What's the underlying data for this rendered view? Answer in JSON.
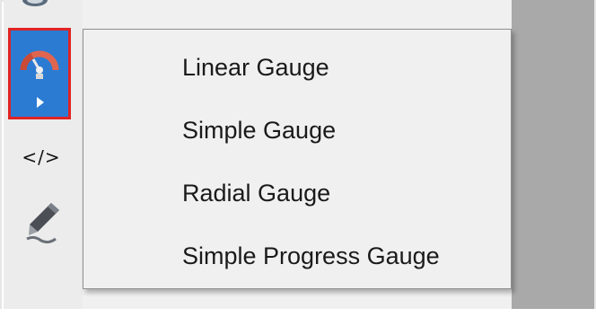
{
  "toolbar": {
    "icons": [
      "partial-icon",
      "gauge-icon",
      "code-icon",
      "pen-icon"
    ],
    "code_label": "</>"
  },
  "menu": {
    "items": [
      {
        "label": "Linear Gauge"
      },
      {
        "label": "Simple Gauge"
      },
      {
        "label": "Radial Gauge"
      },
      {
        "label": "Simple Progress Gauge"
      }
    ]
  },
  "colors": {
    "selected_bg": "#2b7bd3",
    "highlight_border": "#e02323",
    "menu_bg": "#f0f0f0"
  }
}
